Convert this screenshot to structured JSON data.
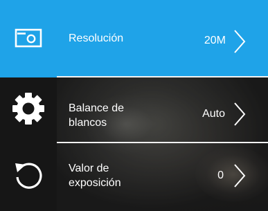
{
  "menu": {
    "items": [
      {
        "label": "Resolución",
        "value": "20M",
        "selected": true
      },
      {
        "label_lines": [
          "Balance de",
          "blancos"
        ],
        "value": "Auto"
      },
      {
        "label_lines": [
          "Valor de",
          "exposición"
        ],
        "value": "0"
      }
    ]
  },
  "sidebar": {
    "items": [
      {
        "icon": "photo-mode-icon",
        "active": true
      },
      {
        "icon": "gear-icon",
        "active": false
      },
      {
        "icon": "reset-icon",
        "active": false
      }
    ]
  },
  "colors": {
    "accent": "#1fa3e8",
    "sidebar_bg": "#161616",
    "text": "#ffffff",
    "divider": "#f2f2f2"
  }
}
